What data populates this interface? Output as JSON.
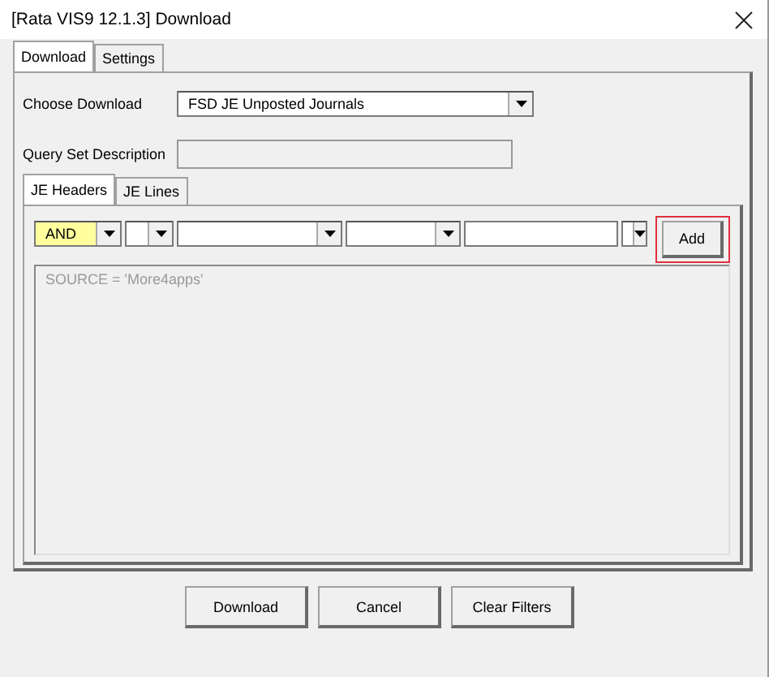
{
  "window": {
    "title": "[Rata VIS9 12.1.3] Download"
  },
  "tabs": [
    {
      "label": "Download",
      "selected": true
    },
    {
      "label": "Settings",
      "selected": false
    }
  ],
  "choose_download": {
    "label": "Choose Download",
    "value": "FSD JE Unposted Journals"
  },
  "query_set_description": {
    "label": "Query Set Description"
  },
  "sub_tabs": [
    {
      "label": "JE Headers",
      "selected": true
    },
    {
      "label": "JE Lines",
      "selected": false
    }
  ],
  "filter_row": [
    {
      "kind": "combo",
      "value": "AND",
      "highlighted": true
    },
    {
      "kind": "combo",
      "highlighted": false
    },
    {
      "kind": "combo",
      "highlighted": false
    },
    {
      "kind": "combo",
      "highlighted": false
    },
    {
      "kind": "field",
      "highlighted": false
    },
    {
      "kind": "combo",
      "highlighted": false
    }
  ],
  "add_button": {
    "label": "Add",
    "outlined": true
  },
  "filter_text": "SOURCE = 'More4apps'",
  "buttons": [
    "Download",
    "Cancel",
    "Clear Filters"
  ]
}
